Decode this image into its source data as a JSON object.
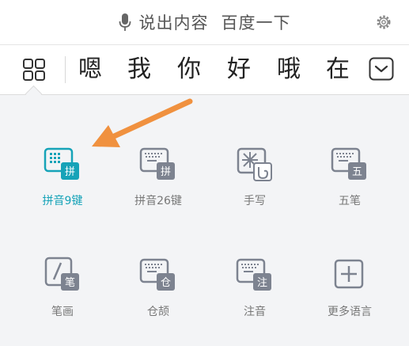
{
  "voice_bar": {
    "text_left": "说出内容",
    "text_right": "百度一下"
  },
  "candidates": [
    "嗯",
    "我",
    "你",
    "好",
    "哦",
    "在"
  ],
  "modes": [
    {
      "label": "拼音9键",
      "badge": "拼"
    },
    {
      "label": "拼音26键",
      "badge": "拼"
    },
    {
      "label": "手写",
      "badge": ""
    },
    {
      "label": "五笔",
      "badge": "五"
    },
    {
      "label": "笔画",
      "badge": "笔"
    },
    {
      "label": "仓颉",
      "badge": "仓"
    },
    {
      "label": "注音",
      "badge": "注"
    },
    {
      "label": "更多语言",
      "badge": ""
    }
  ],
  "colors": {
    "active": "#16a3b8",
    "icon": "#7d8390",
    "arrow": "#f0913f"
  },
  "icons": {
    "voice": "microphone-icon",
    "settings": "gear-icon",
    "layout": "grid-icon",
    "collapse": "chevron-down-icon",
    "more": "plus-icon"
  }
}
